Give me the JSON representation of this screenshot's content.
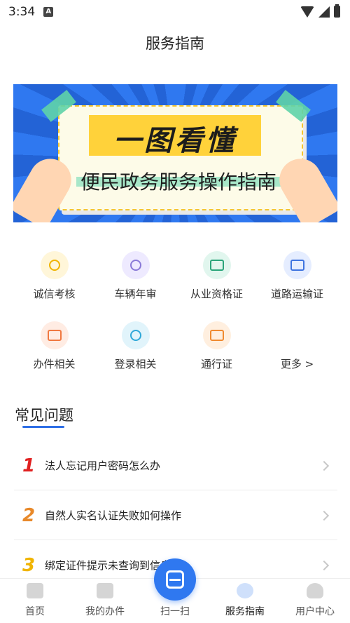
{
  "status_bar": {
    "time": "3:34",
    "notification_icon": "A"
  },
  "header": {
    "title": "服务指南"
  },
  "banner": {
    "headline": "一图看懂",
    "subtitle": "便民政务服务操作指南"
  },
  "services": [
    {
      "label": "诚信考核",
      "icon": "badge-icon",
      "color": "#f0b400",
      "bg": "#fff6d9"
    },
    {
      "label": "车辆年审",
      "icon": "stamp-icon",
      "color": "#8a7ad8",
      "bg": "#eeeaff"
    },
    {
      "label": "从业资格证",
      "icon": "certificate-icon",
      "color": "#2aa57a",
      "bg": "#e1f6ee"
    },
    {
      "label": "道路运输证",
      "icon": "vehicle-card-icon",
      "color": "#3e74e0",
      "bg": "#e5edff"
    },
    {
      "label": "办件相关",
      "icon": "folder-icon",
      "color": "#f07840",
      "bg": "#ffece3"
    },
    {
      "label": "登录相关",
      "icon": "user-icon",
      "color": "#2fa8d8",
      "bg": "#e1f4fb"
    },
    {
      "label": "通行证",
      "icon": "id-card-icon",
      "color": "#f08a30",
      "bg": "#ffefdf"
    },
    {
      "label": "更多 >",
      "icon": "",
      "color": "",
      "bg": ""
    }
  ],
  "faq": {
    "title": "常见问题",
    "items": [
      {
        "num": "1",
        "text": "法人忘记用户密码怎么办",
        "color": "#e02020"
      },
      {
        "num": "2",
        "text": "自然人实名认证失败如何操作",
        "color": "#e8892a"
      },
      {
        "num": "3",
        "text": "绑定证件提示未查询到信息",
        "color": "#f0b400"
      }
    ]
  },
  "tabbar": {
    "items": [
      {
        "label": "首页",
        "icon": "home-icon"
      },
      {
        "label": "我的办件",
        "icon": "document-icon"
      },
      {
        "label": "扫一扫",
        "icon": "scan-icon"
      },
      {
        "label": "服务指南",
        "icon": "compass-icon"
      },
      {
        "label": "用户中心",
        "icon": "user-icon"
      }
    ],
    "active": "服务指南",
    "accent": "#2f78f0"
  }
}
